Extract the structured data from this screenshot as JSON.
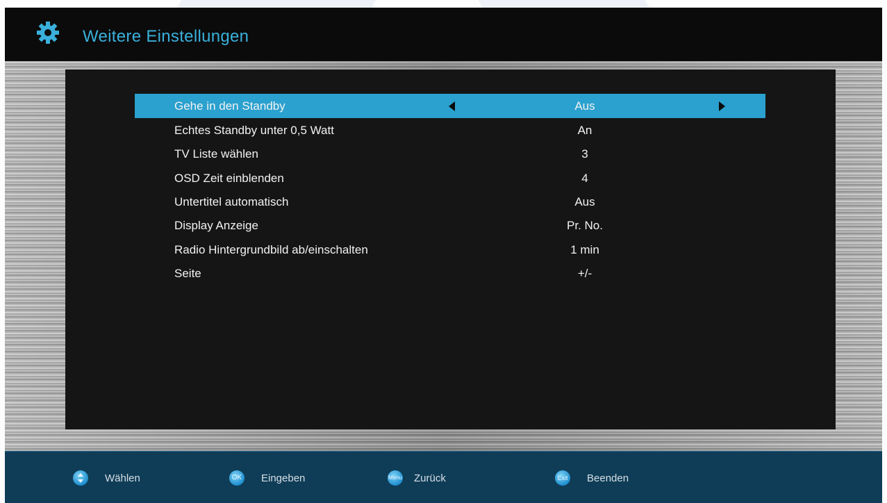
{
  "header": {
    "title": "Weitere Einstellungen",
    "icon": "gear-icon"
  },
  "accent_color": "#2aa1cf",
  "menu": {
    "items": [
      {
        "label": "Gehe in den Standby",
        "value": "Aus",
        "selected": true
      },
      {
        "label": "Echtes Standby unter 0,5 Watt",
        "value": "An"
      },
      {
        "label": "TV Liste wählen",
        "value": "3"
      },
      {
        "label": "OSD Zeit einblenden",
        "value": "4"
      },
      {
        "label": "Untertitel automatisch",
        "value": "Aus"
      },
      {
        "label": "Display Anzeige",
        "value": "Pr. No."
      },
      {
        "label": "Radio Hintergrundbild ab/einschalten",
        "value": "1 min"
      },
      {
        "label": "Seite",
        "value": "+/-"
      }
    ]
  },
  "footer": {
    "items": [
      {
        "button": "",
        "icon": "up-down-arrows-icon",
        "label": "Wählen"
      },
      {
        "button": "OK",
        "icon": "ok-button-icon",
        "label": "Eingeben"
      },
      {
        "button": "Menu",
        "icon": "menu-button-icon",
        "label": "Zurück"
      },
      {
        "button": "Exit",
        "icon": "exit-button-icon",
        "label": "Beenden"
      }
    ]
  }
}
